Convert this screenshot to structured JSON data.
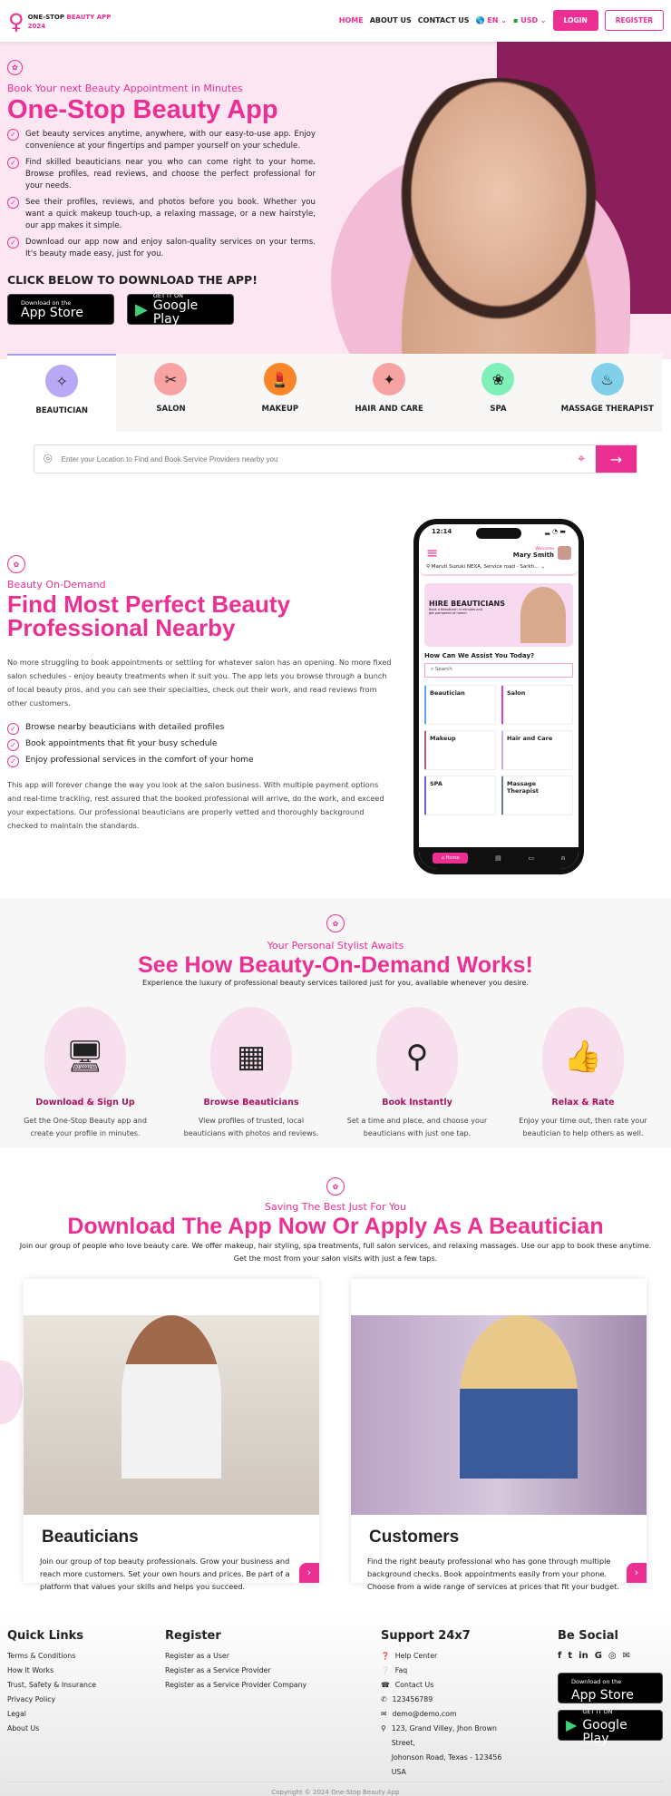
{
  "header": {
    "logo_a": "ONE-STOP",
    "logo_b": "BEAUTY APP",
    "logo_c": "2024",
    "nav": [
      "HOME",
      "ABOUT US",
      "CONTACT US"
    ],
    "lang": "EN",
    "currency": "USD",
    "login": "LOGIN",
    "register": "REGISTER"
  },
  "hero": {
    "tagline": "Book Your next Beauty Appointment in Minutes",
    "title": "One-Stop Beauty App",
    "bullets": [
      "Get beauty services anytime, anywhere, with our easy-to-use app. Enjoy convenience at your fingertips and pamper yourself on your schedule.",
      "Find skilled beauticians near you who can come right to your home. Browse profiles, read reviews, and choose the perfect professional for your needs.",
      "See their profiles, reviews, and photos before you book. Whether you want a quick makeup touch-up, a relaxing massage, or a new hairstyle, our app makes it simple.",
      "Download our app now and enjoy salon-quality services on your terms. It's beauty made easy, just for you."
    ],
    "cta": "CLICK BELOW TO DOWNLOAD THE APP!",
    "appstore_small": "Download on the",
    "appstore": "App Store",
    "gplay_small": "GET IT ON",
    "gplay": "Google Play"
  },
  "tabs": [
    {
      "label": "BEAUTICIAN",
      "color": "#b9a8f5"
    },
    {
      "label": "SALON",
      "color": "#f7a3a3"
    },
    {
      "label": "MAKEUP",
      "color": "#f9852a"
    },
    {
      "label": "HAIR AND CARE",
      "color": "#f7a3a3"
    },
    {
      "label": "SPA",
      "color": "#7ef0b8"
    },
    {
      "label": "MASSAGE THERAPIST",
      "color": "#7fd0e8"
    }
  ],
  "search": {
    "placeholder": "Enter your Location to Find and Book Service Providers nearby you"
  },
  "ondemand": {
    "tagline": "Beauty On-Demand",
    "title": "Find Most Perfect Beauty Professional Nearby",
    "p1": "No more struggling to book appointments or settling for whatever salon has an opening. No more fixed salon schedules - enjoy beauty treatments when it suit you. The app lets you browse through a bunch of local beauty pros, and you can see their specialties, check out their work, and read reviews from other customers.",
    "bullets": [
      "Browse nearby beauticians with detailed profiles",
      "Book appointments that fit your busy schedule",
      "Enjoy professional services in the comfort of your home"
    ],
    "p2": "This app will forever change the way you look at the salon business. With multiple payment options and real-time tracking, rest assured that the booked professional will arrive, do the work, and exceed your expectations. Our professional beauticians are properly vetted and thoroughly background checked to maintain the standards."
  },
  "phone": {
    "time": "12:14",
    "welcome": "Welcome",
    "user": "Mary Smith",
    "location": "Maruti Suzuki NEXA, Service road - Sarkh...",
    "banner_title": "HIRE BEAUTICIANS",
    "banner_sub": "Book a Beautician in minutes and get pampered at home!",
    "assist": "How Can We Assist You Today?",
    "search": "Search",
    "cards": [
      {
        "label": "Beautician",
        "color": "#5aa9f0"
      },
      {
        "label": "Salon",
        "color": "#e03ad8"
      },
      {
        "label": "Makeup",
        "color": "#b05a78"
      },
      {
        "label": "Hair and Care",
        "color": "#c8a8f0"
      },
      {
        "label": "SPA",
        "color": "#7a5ad0"
      },
      {
        "label": "Massage Therapist",
        "color": "#6a7a90"
      }
    ],
    "home": "Home"
  },
  "works": {
    "tagline": "Your Personal Stylist Awaits",
    "title": "See How Beauty-On-Demand Works!",
    "sub": "Experience the luxury of professional beauty services tailored just for you, available whenever you desire.",
    "steps": [
      {
        "title": "Download & Sign Up",
        "text": "Get the One-Stop Beauty app and create your profile in minutes.",
        "icon": "monitor-user-icon"
      },
      {
        "title": "Browse Beauticians",
        "text": "View profiles of trusted, local beauticians with photos and reviews.",
        "icon": "grid-tap-icon"
      },
      {
        "title": "Book Instantly",
        "text": "Set a time and place, and choose your beauticians with just one tap.",
        "icon": "route-pin-icon"
      },
      {
        "title": "Relax & Rate",
        "text": "Enjoy your time out, then rate your beautician to help others as well.",
        "icon": "thumbs-stars-icon"
      }
    ]
  },
  "apply": {
    "tagline": "Saving The Best Just For You",
    "title": "Download The App Now Or Apply As A Beautician",
    "sub": "Join our group of people who love beauty care. We offer makeup, hair styling, spa treatments, full salon services, and relaxing massages. Use our app to book these anytime. Get the most from your salon visits with just a few taps.",
    "cards": [
      {
        "title": "Beauticians",
        "text": "Join our group of top beauty professionals. Grow your business and reach more customers. Set your own hours and prices. Be part of a platform that values your skills and helps you succeed."
      },
      {
        "title": "Customers",
        "text": "Find the right beauty professional who has gone through multiple background checks. Book appointments easily from your phone. Choose from a wide range of services at prices that fit your budget."
      }
    ]
  },
  "footer": {
    "quick_title": "Quick Links",
    "quick": [
      "Terms & Conditions",
      "How It Works",
      "Trust, Safety & Insurance",
      "Privacy Policy",
      "Legal",
      "About Us"
    ],
    "reg_title": "Register",
    "reg": [
      "Register as a User",
      "Register as a Service Provider",
      "Register as a Service Provider Company"
    ],
    "sup_title": "Support 24x7",
    "support": {
      "help": "Help Center",
      "faq": "Faq",
      "contact": "Contact Us",
      "phone": "123456789",
      "email": "demo@demo.com",
      "address": "123, Grand Villey, Jhon Brown Street,",
      "address2": "Johonson Road, Texas - 123456",
      "country": "USA"
    },
    "social_title": "Be Social",
    "copyright": "Copyright © 2024 One-Stop Beauty App"
  },
  "colors": {
    "accent": "#ec2f93",
    "hero_bg": "#fce6f2",
    "hero_dark": "#8b1f5c"
  }
}
